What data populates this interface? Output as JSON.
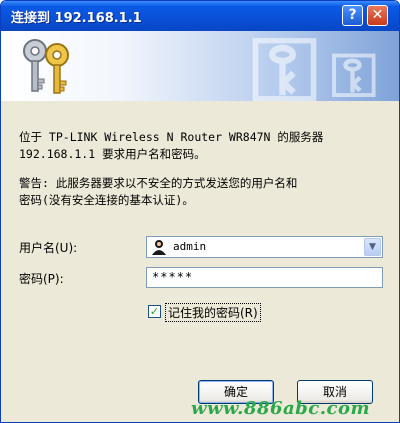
{
  "window": {
    "title": "连接到 192.168.1.1",
    "help_label": "?",
    "close_label": "✕"
  },
  "message": {
    "line1": "位于 TP-LINK Wireless N Router WR847N 的服务器",
    "line2": "192.168.1.1 要求用户名和密码。",
    "warning1": "警告: 此服务器要求以不安全的方式发送您的用户名和",
    "warning2": "密码(没有安全连接的基本认证)。"
  },
  "form": {
    "username_label": "用户名(U):",
    "username_value": "admin",
    "password_label": "密码(P):",
    "password_value": "*****",
    "remember_label": "记住我的密码(R)",
    "remember_checked": true
  },
  "buttons": {
    "ok": "确定",
    "cancel": "取消"
  },
  "watermark": "www.886abc.com",
  "colors": {
    "titlebar": "#0a51d8",
    "dialog_bg": "#ece9d8",
    "check": "#21a121",
    "watermark": "#2aa84a"
  },
  "icons": {
    "banner": "keys-icon",
    "username": "user-icon",
    "dropdown": "chevron-down-icon"
  }
}
